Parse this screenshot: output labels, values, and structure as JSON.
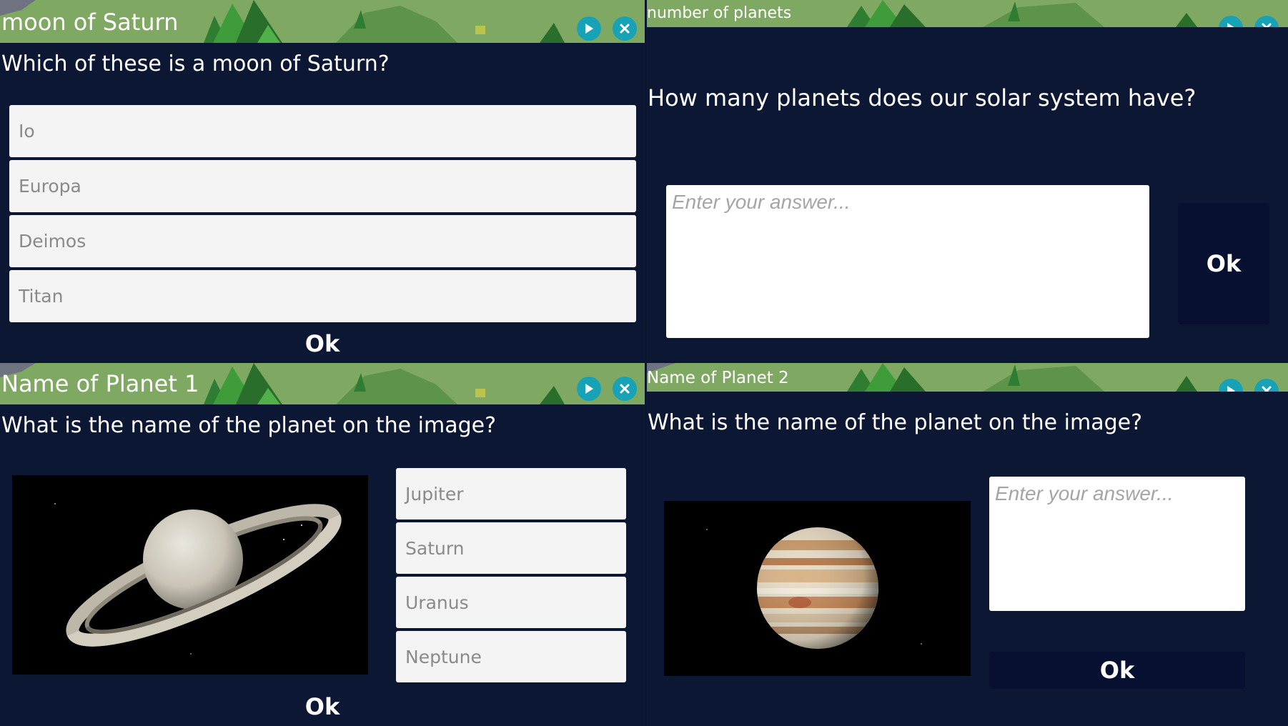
{
  "panels": [
    {
      "title": "moon of Saturn",
      "question": "Which of these is a moon of Saturn?",
      "options": [
        "Io",
        "Europa",
        "Deimos",
        "Titan"
      ],
      "ok_label": "Ok"
    },
    {
      "title": "number of planets",
      "question": "How many planets does our solar system have?",
      "answer_placeholder": "Enter your answer...",
      "ok_label": "Ok"
    },
    {
      "title": "Name of Planet 1",
      "question": "What is the name of the planet on the image?",
      "options": [
        "Jupiter",
        "Saturn",
        "Uranus",
        "Neptune"
      ],
      "image": "saturn-image",
      "ok_label": "Ok"
    },
    {
      "title": "Name of Planet 2",
      "question": "What is the name of the planet on the image?",
      "answer_placeholder": "Enter your answer...",
      "image": "jupiter-image",
      "ok_label": "Ok"
    }
  ],
  "icons": {
    "play": "play-icon",
    "close": "close-icon"
  },
  "colors": {
    "banner": "#7fa863",
    "panel_bg": "#0c1733",
    "button_teal": "#17a3b5",
    "ok_button": "#071030"
  }
}
